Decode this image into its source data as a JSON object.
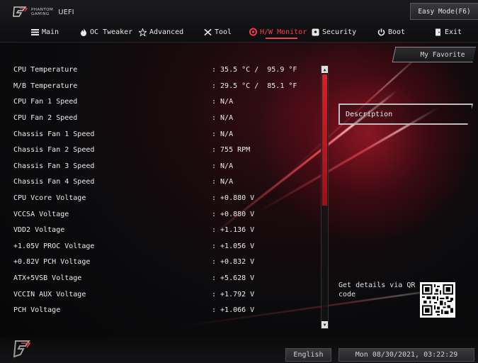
{
  "header": {
    "brand_line1": "PHANTOM",
    "brand_line2": "GAMING",
    "uefi": "UEFI",
    "easy_mode": "Easy Mode(F6)"
  },
  "tabs": [
    {
      "label": "Main",
      "icon": "menu-icon"
    },
    {
      "label": "OC Tweaker",
      "icon": "flame-icon"
    },
    {
      "label": "Advanced",
      "icon": "star-icon"
    },
    {
      "label": "Tool",
      "icon": "tools-icon"
    },
    {
      "label": "H/W Monitor",
      "icon": "monitor-icon",
      "active": true
    },
    {
      "label": "Security",
      "icon": "shield-icon"
    },
    {
      "label": "Boot",
      "icon": "power-icon"
    },
    {
      "label": "Exit",
      "icon": "exit-door-icon"
    }
  ],
  "rows": [
    {
      "label": "CPU Temperature",
      "value": ": 35.5 °C /  95.9 °F"
    },
    {
      "label": "M/B Temperature",
      "value": ": 29.5 °C /  85.1 °F"
    },
    {
      "label": "CPU Fan 1 Speed",
      "value": ": N/A"
    },
    {
      "label": "CPU Fan 2 Speed",
      "value": ": N/A"
    },
    {
      "label": "Chassis Fan 1 Speed",
      "value": ": N/A"
    },
    {
      "label": "Chassis Fan 2 Speed",
      "value": ": 755 RPM"
    },
    {
      "label": "Chassis Fan 3 Speed",
      "value": ": N/A"
    },
    {
      "label": "Chassis Fan 4 Speed",
      "value": ": N/A"
    },
    {
      "label": "CPU Vcore Voltage",
      "value": ": +0.880 V"
    },
    {
      "label": "VCCSA Voltage",
      "value": ": +0.880 V"
    },
    {
      "label": "VDD2 Voltage",
      "value": ": +1.136 V"
    },
    {
      "label": "+1.05V PROC Voltage",
      "value": ": +1.056 V"
    },
    {
      "label": "+0.82V PCH Voltage",
      "value": ": +0.832 V"
    },
    {
      "label": "ATX+5VSB Voltage",
      "value": ": +5.628 V"
    },
    {
      "label": "VCCIN AUX Voltage",
      "value": ": +1.792 V"
    },
    {
      "label": "PCH Voltage",
      "value": ": +1.066 V"
    }
  ],
  "sidebar": {
    "my_favorite": "My Favorite",
    "description": "Description",
    "qr_text": "Get details via QR code"
  },
  "footer": {
    "language": "English",
    "datetime": "Mon 08/30/2021, 03:22:29"
  },
  "colors": {
    "accent": "#ff3c45",
    "scroll_thumb": "#d8202c"
  }
}
